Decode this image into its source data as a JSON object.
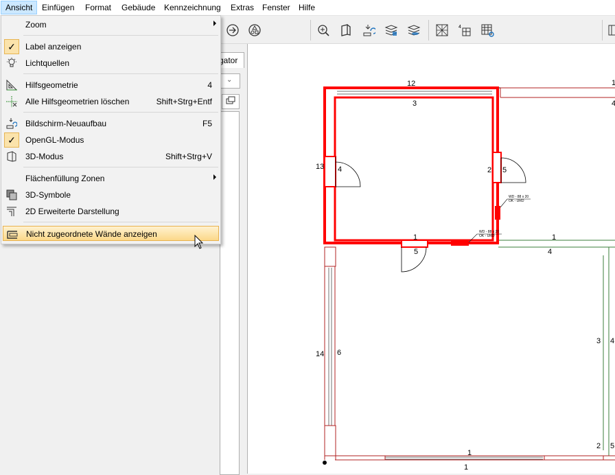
{
  "menubar": {
    "items": [
      "Ansicht",
      "Einfügen",
      "Format",
      "Gebäude",
      "Kennzeichnung",
      "Extras",
      "Fenster",
      "Hilfe"
    ],
    "active_index": 0
  },
  "toolbar": {
    "icons": [
      "arrow-circle-icon",
      "shapes-circle-icon",
      "zoom-plan-icon",
      "wall-3d-icon",
      "redraw-icon",
      "layer-stack-icon",
      "layer-fill-icon",
      "grid-pattern-icon",
      "grid-number-icon",
      "grid-table-icon",
      "panel-icon"
    ]
  },
  "navigator": {
    "tab_label": "gator"
  },
  "menu": {
    "items": [
      {
        "label": "Zoom",
        "shortcut": "",
        "submenu": true,
        "checked": false,
        "icon": ""
      },
      {
        "label": "Label anzeigen",
        "shortcut": "",
        "submenu": false,
        "checked": true,
        "icon": ""
      },
      {
        "label": "Lichtquellen",
        "shortcut": "",
        "submenu": false,
        "checked": false,
        "icon": "lightbulb-icon"
      },
      {
        "label": "Hilfsgeometrie",
        "shortcut": "4",
        "submenu": false,
        "checked": false,
        "icon": "set-square-icon"
      },
      {
        "label": "Alle Hilfsgeometrien löschen",
        "shortcut": "Shift+Strg+Entf",
        "submenu": false,
        "checked": false,
        "icon": "delete-guides-icon"
      },
      {
        "label": "Bildschirm-Neuaufbau",
        "shortcut": "F5",
        "submenu": false,
        "checked": false,
        "icon": "refresh-screen-icon"
      },
      {
        "label": "OpenGL-Modus",
        "shortcut": "",
        "submenu": false,
        "checked": true,
        "icon": ""
      },
      {
        "label": "3D-Modus",
        "shortcut": "Shift+Strg+V",
        "submenu": false,
        "checked": false,
        "icon": "cube-3d-icon"
      },
      {
        "label": "Flächenfüllung Zonen",
        "shortcut": "",
        "submenu": true,
        "checked": false,
        "icon": ""
      },
      {
        "label": "3D-Symbole",
        "shortcut": "",
        "submenu": false,
        "checked": false,
        "icon": "symbols-3d-icon"
      },
      {
        "label": "2D Erweiterte Darstellung",
        "shortcut": "",
        "submenu": false,
        "checked": false,
        "icon": "extended-2d-icon"
      },
      {
        "label": "Nicht zugeordnete Wände anzeigen",
        "shortcut": "",
        "submenu": false,
        "checked": false,
        "icon": "unassigned-walls-icon",
        "highlighted": true
      }
    ]
  },
  "plan": {
    "labels": [
      "12",
      "3",
      "4",
      "13",
      "4",
      "2",
      "5",
      "1",
      "5",
      "1",
      "4",
      "3",
      "14",
      "6",
      "2",
      "1",
      "1",
      "5",
      "4",
      "1"
    ],
    "tag_text": [
      "WD - 88 x 20",
      "OK - URD",
      "WD - 88 x 20",
      "OK - URD"
    ],
    "colors": {
      "red": "#ff0000",
      "green": "#3a7d3a",
      "gray": "#707070"
    }
  }
}
